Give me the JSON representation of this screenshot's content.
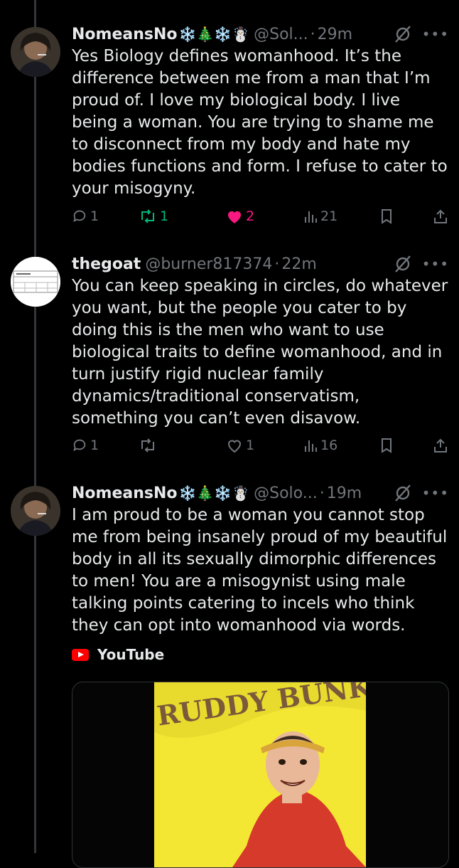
{
  "tweets": [
    {
      "name": "NomeansNo",
      "name_emoji": "❄️🎄❄️☃️",
      "handle": "@Sol...",
      "time": "29m",
      "text": "Yes Biology defines womanhood. It’s the difference between me from a man that I’m proud of. I love my biological body. I live being a woman. You are trying to shame me to disconnect from my body and hate my bodies functions and form. I refuse to cater to your misogyny.",
      "replies": "1",
      "reposts": "1",
      "likes": "2",
      "views": "21",
      "reposted": true,
      "liked": true
    },
    {
      "name": "thegoat",
      "name_emoji": "",
      "handle": "@burner817374",
      "time": "22m",
      "text": "You can keep speaking in circles, do whatever you want, but the people you cater to by doing this is the men who want to use biological traits to define womanhood, and in turn justify rigid nuclear family dynamics/traditional conservatism, something you can’t even disavow.",
      "replies": "1",
      "reposts": "",
      "likes": "1",
      "views": "16",
      "reposted": false,
      "liked": false
    },
    {
      "name": "NomeansNo",
      "name_emoji": "❄️🎄❄️☃️",
      "handle": "@Solo...",
      "time": "19m",
      "text": "I am proud to be a woman you cannot stop me from being insanely proud of my beautiful body in all its sexually dimorphic differences to men! You are a misogynist using male talking points catering to incels who think they can opt into womanhood via words."
    }
  ],
  "embed": {
    "source": "YouTube",
    "album_text": "RUDDY BUNK"
  },
  "colors": {
    "background": "#000000",
    "text": "#e7e9ea",
    "muted": "#71767b",
    "repost_active": "#00ba7c",
    "like_active": "#f91880",
    "youtube_red": "#ff0000"
  }
}
